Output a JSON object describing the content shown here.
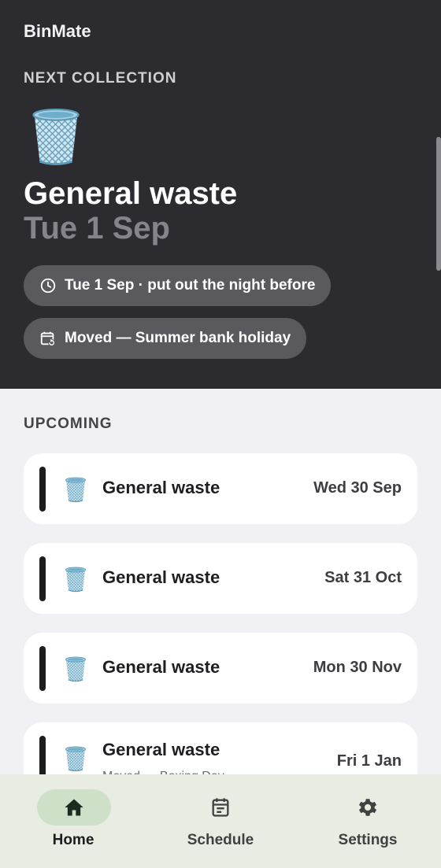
{
  "app": {
    "title": "BinMate"
  },
  "next": {
    "section_label": "NEXT COLLECTION",
    "icon": "wastebasket-icon",
    "title": "General waste",
    "date": "Tue 1 Sep",
    "chips": [
      {
        "icon": "clock-icon",
        "label": "Tue 1 Sep · put out the night before"
      },
      {
        "icon": "calendar-moved-icon",
        "label": "Moved — Summer bank holiday"
      }
    ]
  },
  "upcoming": {
    "section_label": "UPCOMING",
    "items": [
      {
        "icon": "wastebasket-icon",
        "name": "General waste",
        "date": "Wed 30 Sep",
        "note": ""
      },
      {
        "icon": "wastebasket-icon",
        "name": "General waste",
        "date": "Sat 31 Oct",
        "note": ""
      },
      {
        "icon": "wastebasket-icon",
        "name": "General waste",
        "date": "Mon 30 Nov",
        "note": ""
      },
      {
        "icon": "wastebasket-icon",
        "name": "General waste",
        "date": "Fri 1 Jan",
        "note": "Moved — Boxing Day"
      }
    ]
  },
  "nav": {
    "items": [
      {
        "icon": "home-icon",
        "label": "Home",
        "active": true
      },
      {
        "icon": "schedule-icon",
        "label": "Schedule",
        "active": false
      },
      {
        "icon": "settings-gear-icon",
        "label": "Settings",
        "active": false
      }
    ]
  },
  "colors": {
    "hero_bg": "#2c2b30",
    "page_bg": "#f1f0f5",
    "nav_bg": "#e9ece3",
    "nav_active_pill": "#cfe0c9",
    "chip_bg": "#5a595e"
  }
}
